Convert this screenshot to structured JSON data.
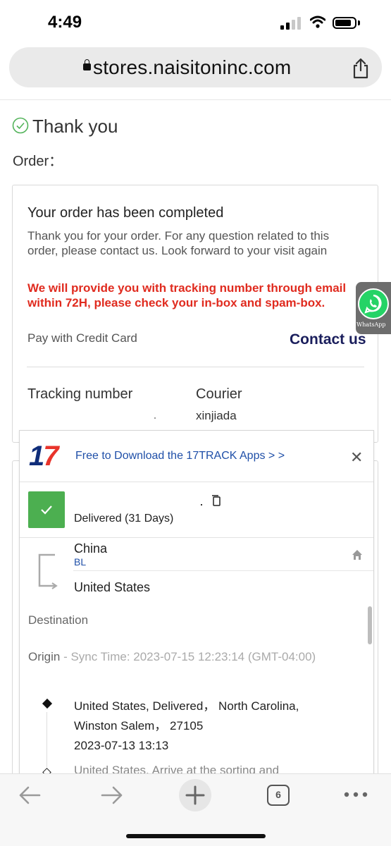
{
  "status_bar": {
    "time": "4:49"
  },
  "browser": {
    "url": "stores.naisitoninc.com",
    "tab_count": "6"
  },
  "page": {
    "heading": "Thank you",
    "order_label": "Order：",
    "card": {
      "title": "Your order has been completed",
      "message": "Thank you for your order. For any question related to this order, please contact us. Look forward to your visit again",
      "warning": "We will provide you with tracking number through email within 72H, please check your in-box and spam-box.",
      "payment": "Pay with Credit Card",
      "contact_label": "Contact us",
      "tracking_label": "Tracking number",
      "courier_label": "Courier",
      "courier_value": "xinjiada"
    },
    "whatsapp_label": "WhatsApp"
  },
  "tracker": {
    "logo": "17",
    "download_link": "Free to Download the 17TRACK Apps > >",
    "status": "Delivered (31 Days)",
    "origin_country": "China",
    "carrier_code": "BL",
    "destination_country": "United States",
    "destination_label": "Destination",
    "origin_label": "Origin",
    "sync_time": " - Sync Time: 2023-07-15 12:23:14 (GMT-04:00)",
    "events": [
      {
        "line1": "United States, Delivered， North Carolina,",
        "line2": "Winston Salem， 27105",
        "time": "2023-07-13 13:13"
      },
      {
        "line1": "United States, Arrive at the sorting and"
      }
    ]
  }
}
